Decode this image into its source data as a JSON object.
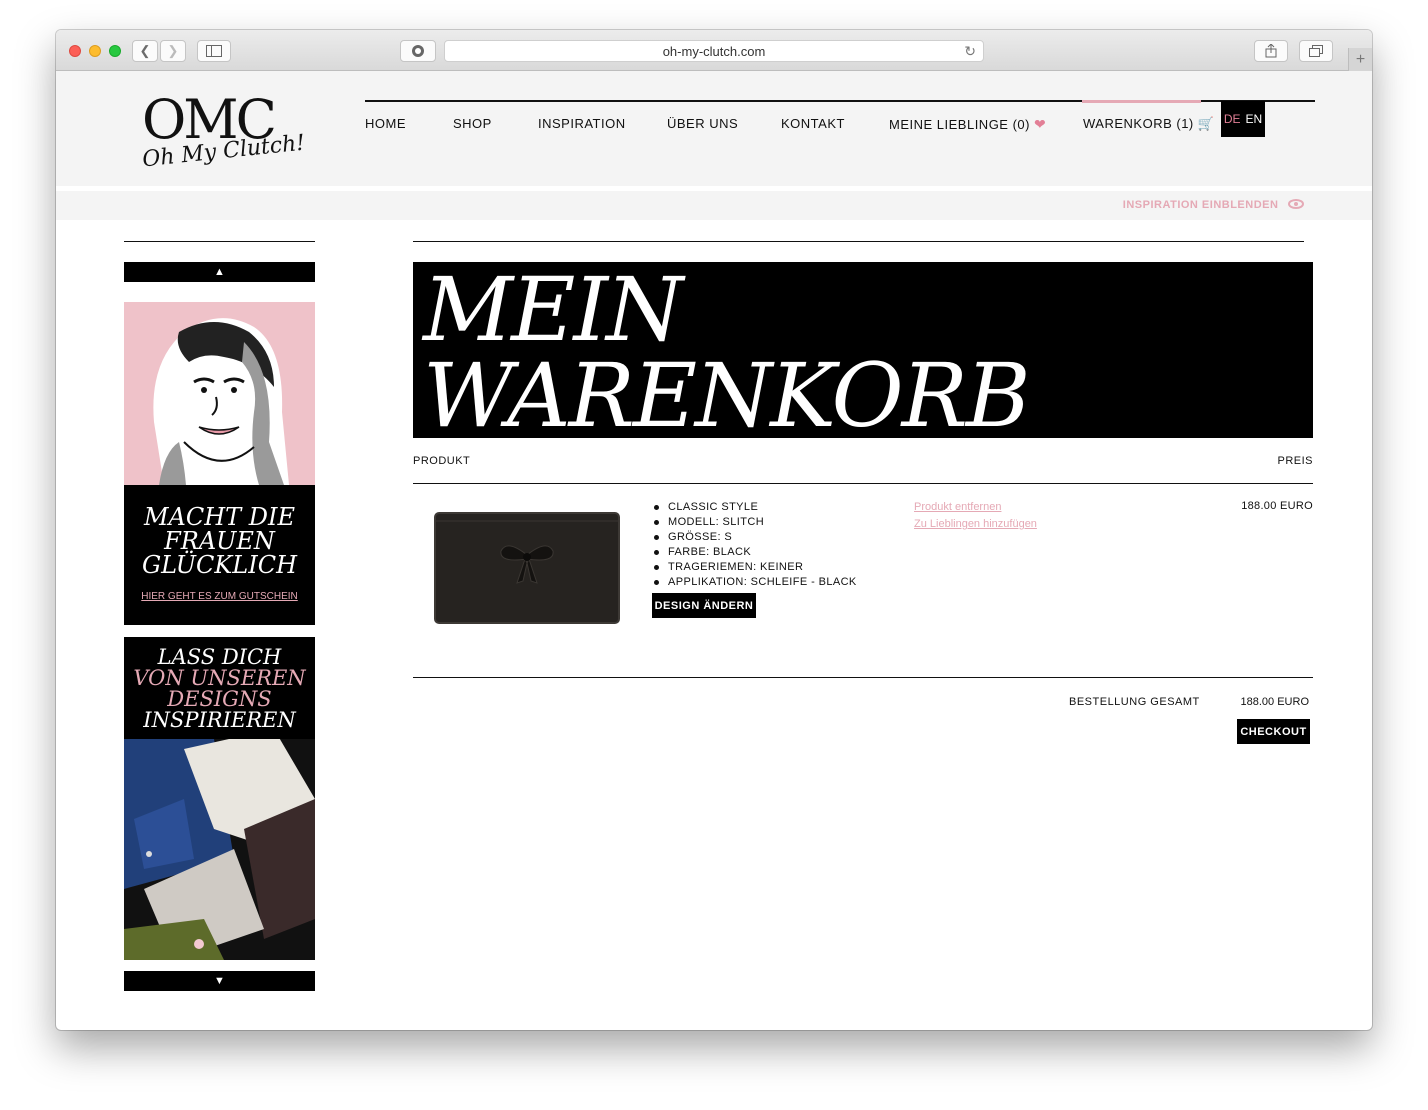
{
  "browser": {
    "url": "oh-my-clutch.com"
  },
  "header": {
    "logo_main": "OMC",
    "logo_sub": "Oh My Clutch!",
    "nav": {
      "home": "HOME",
      "shop": "SHOP",
      "inspiration": "INSPIRATION",
      "about": "ÜBER UNS",
      "contact": "KONTAKT",
      "favorites": "MEINE LIEBLINGE (0)",
      "cart": "WARENKORB (1)"
    },
    "lang_de": "DE",
    "lang_en": "EN",
    "inspiration_toggle": "INSPIRATION EINBLENDEN"
  },
  "sidebar": {
    "promo1": {
      "title_line1": "MACHT DIE",
      "title_line2": "FRAUEN",
      "title_line3": "GLÜCKLICH",
      "link": "HIER GEHT ES ZUM GUTSCHEIN"
    },
    "promo2": {
      "line1": "LASS DICH",
      "line2": "VON UNSEREN",
      "line3": "DESIGNS",
      "line4": "INSPIRIEREN"
    }
  },
  "cart": {
    "heading_line1": "MEIN",
    "heading_line2": "WARENKORB",
    "col_product": "PRODUKT",
    "col_price": "PREIS",
    "item": {
      "specs": [
        "CLASSIC STYLE",
        "MODELL: SLITCH",
        "GRÖSSE: S",
        "FARBE: BLACK",
        "TRAGERIEMEN: KEINER",
        "APPLIKATION: SCHLEIFE - BLACK"
      ],
      "design_button": "DESIGN ÄNDERN",
      "remove_link": "Produkt entfernen",
      "favorite_link": "Zu Lieblingen hinzufügen",
      "price": "188.00 EURO"
    },
    "total_label": "BESTELLUNG GESAMT",
    "total_value": "188.00 EURO",
    "checkout_button": "CHECKOUT"
  },
  "colors": {
    "accent_pink": "#e5a9b5",
    "heart_pink": "#e27f96",
    "black": "#000000",
    "header_bg": "#f4f4f4"
  }
}
